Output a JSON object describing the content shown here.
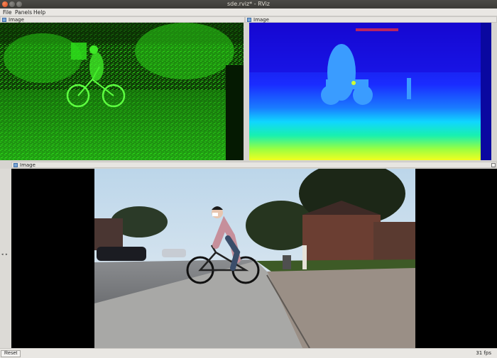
{
  "window": {
    "title": "sde.rviz* - RViz"
  },
  "menu": {
    "file": "File",
    "panels": "Panels",
    "help": "Help"
  },
  "panels": {
    "top_left": {
      "title": "Image"
    },
    "top_right": {
      "title": "Image"
    },
    "bottom": {
      "title": "Image"
    }
  },
  "status": {
    "reset_label": "Reset",
    "fps": "31 fps"
  },
  "colors": {
    "titlebar": "#3c3b37",
    "close": "#e95420",
    "edge_green": "#2ee01c",
    "depth_blue": "#1a2cff",
    "depth_yellow": "#f0ff20"
  },
  "icons": {
    "close": "close-icon",
    "panel": "image-panel-icon"
  }
}
